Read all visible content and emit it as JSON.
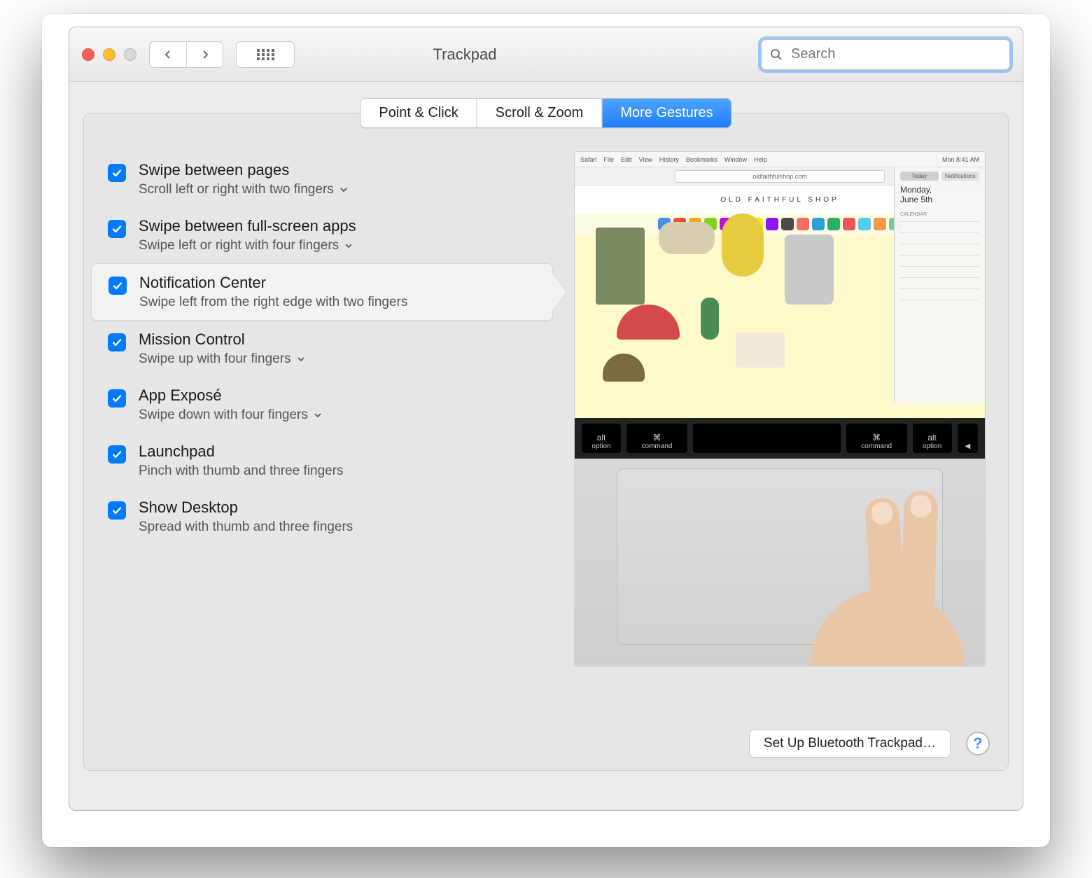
{
  "window": {
    "title": "Trackpad"
  },
  "search": {
    "placeholder": "Search",
    "value": ""
  },
  "tabs": [
    {
      "label": "Point & Click",
      "active": false
    },
    {
      "label": "Scroll & Zoom",
      "active": false
    },
    {
      "label": "More Gestures",
      "active": true
    }
  ],
  "gestures": [
    {
      "title": "Swipe between pages",
      "subtitle": "Scroll left or right with two fingers",
      "dropdown": true,
      "checked": true,
      "selected": false
    },
    {
      "title": "Swipe between full-screen apps",
      "subtitle": "Swipe left or right with four fingers",
      "dropdown": true,
      "checked": true,
      "selected": false
    },
    {
      "title": "Notification Center",
      "subtitle": "Swipe left from the right edge with two fingers",
      "dropdown": false,
      "checked": true,
      "selected": true
    },
    {
      "title": "Mission Control",
      "subtitle": "Swipe up with four fingers",
      "dropdown": true,
      "checked": true,
      "selected": false
    },
    {
      "title": "App Exposé",
      "subtitle": "Swipe down with four fingers",
      "dropdown": true,
      "checked": true,
      "selected": false
    },
    {
      "title": "Launchpad",
      "subtitle": "Pinch with thumb and three fingers",
      "dropdown": false,
      "checked": true,
      "selected": false
    },
    {
      "title": "Show Desktop",
      "subtitle": "Spread with thumb and three fingers",
      "dropdown": false,
      "checked": true,
      "selected": false
    }
  ],
  "preview": {
    "menubar": [
      "Safari",
      "File",
      "Edit",
      "View",
      "History",
      "Bookmarks",
      "Window",
      "Help"
    ],
    "menubar_right": "Mon 8:41 AM",
    "address": "oldfaithfulshop.com",
    "page_title": "OLD FAITHFUL SHOP",
    "nc": {
      "tabs": [
        "Today",
        "Notifications"
      ],
      "day_line1": "Monday,",
      "day_line2": "June 5th",
      "section": "CALENDAR"
    },
    "keys": [
      "alt option",
      "⌘ command",
      "",
      "⌘ command",
      "alt option",
      "◀"
    ]
  },
  "footer": {
    "bt_button": "Set Up Bluetooth Trackpad…"
  }
}
